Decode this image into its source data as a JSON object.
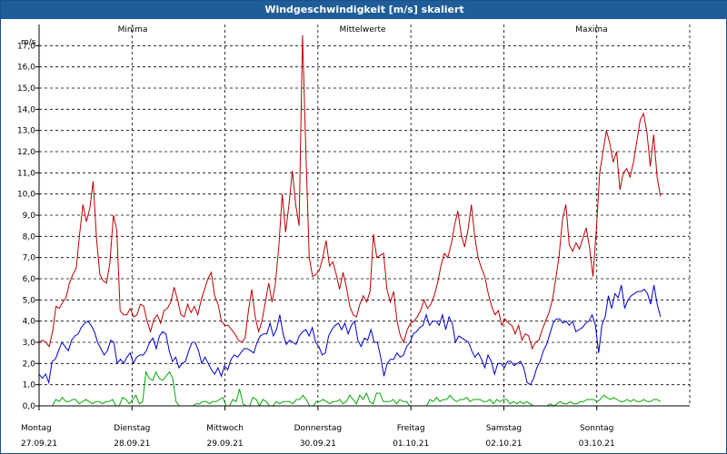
{
  "window": {
    "title": "Windgeschwindigkeit [m/s] skaliert"
  },
  "chart_data": {
    "type": "line",
    "title": "Windgeschwindigkeit [m/s] skaliert",
    "ylabel": "m/s",
    "ylim": [
      0,
      18
    ],
    "y_ticks": [
      "0,0",
      "1,0",
      "2,0",
      "3,0",
      "4,0",
      "5,0",
      "6,0",
      "7,0",
      "8,0",
      "9,0",
      "10,0",
      "11,0",
      "12,0",
      "13,0",
      "14,0",
      "15,0",
      "16,0",
      "17,0"
    ],
    "x_range_days": [
      0,
      7
    ],
    "x_ticks": [
      {
        "day": "Montag",
        "date": "27.09.21"
      },
      {
        "day": "Dienstag",
        "date": "28.09.21"
      },
      {
        "day": "Mittwoch",
        "date": "29.09.21"
      },
      {
        "day": "Donnerstag",
        "date": "30.09.21"
      },
      {
        "day": "Freitag",
        "date": "01.10.21"
      },
      {
        "day": "Samstag",
        "date": "02.10.21"
      },
      {
        "day": "Sonntag",
        "date": "03.10.21"
      }
    ],
    "grid": true,
    "legend_position": "top",
    "series": [
      {
        "name": "Minima",
        "color": "#00aa00",
        "values": [
          0,
          0,
          0,
          0,
          0,
          0.3,
          0.2,
          0.4,
          0.2,
          0.2,
          0.3,
          0.3,
          0.1,
          0.2,
          0.3,
          0.2,
          0.1,
          0.2,
          0.2,
          0.1,
          0.2,
          0.2,
          0.3,
          0,
          0,
          0.4,
          0.3,
          0.1,
          0.3,
          0.5,
          0.1,
          0.2,
          1.6,
          1.3,
          1.2,
          1.6,
          1.3,
          1.2,
          1.4,
          1.6,
          1.3,
          0.2,
          0,
          0,
          0,
          0,
          0,
          0.1,
          0.1,
          0.2,
          0.2,
          0.1,
          0.2,
          0.2,
          0.3,
          0.4,
          0,
          0,
          0.3,
          0.2,
          0.8,
          0.1,
          0,
          0,
          0.4,
          0.3,
          0,
          0.3,
          0.2,
          0,
          0,
          0.2,
          0.1,
          0.2,
          0.2,
          0.2,
          0.1,
          0.3,
          0.3,
          0.5,
          0.3,
          0,
          0,
          0.2,
          0.2,
          0.3,
          0.2,
          0.1,
          0.2,
          0.2,
          0.3,
          0.1,
          0.2,
          0.5,
          0.3,
          0.1,
          0.5,
          0.3,
          0.6,
          0.2,
          0.1,
          0.6,
          0.6,
          0.2,
          0.2,
          0.2,
          0.3,
          0.1,
          0.3,
          0.2,
          0.2,
          0,
          0,
          0,
          0,
          0,
          0,
          0.3,
          0.2,
          0.4,
          0.2,
          0.3,
          0.3,
          0.5,
          0.3,
          0.2,
          0.3,
          0.3,
          0.4,
          0.2,
          0.3,
          0.3,
          0.3,
          0.2,
          0.2,
          0.3,
          0.1,
          0.3,
          0.2,
          0.3,
          0.3,
          0.1,
          0.2,
          0.1,
          0.2,
          0.1,
          0.2,
          0.1,
          0,
          0,
          0,
          0,
          0,
          0.1,
          0,
          0.1,
          0.2,
          0.1,
          0.1,
          0.2,
          0.1,
          0.1,
          0.2,
          0.2,
          0.3,
          0.3,
          0.3,
          0.2,
          0.3,
          0.5,
          0.4,
          0.3,
          0.4,
          0.3,
          0.2,
          0.2,
          0.3,
          0.2,
          0.3,
          0.2,
          0.2,
          0.3,
          0.2,
          0.2,
          0.3,
          0.3,
          0.2
        ]
      },
      {
        "name": "Mittelwerte",
        "color": "#0000cc",
        "values": [
          1.5,
          1.3,
          1.5,
          1.1,
          2.1,
          2.2,
          2.6,
          3.0,
          2.8,
          2.6,
          3.1,
          3.3,
          3.4,
          3.7,
          3.9,
          4.0,
          3.8,
          3.5,
          3.0,
          2.7,
          2.4,
          2.6,
          3.1,
          3.0,
          2.0,
          2.2,
          2.0,
          2.3,
          2.5,
          2.0,
          2.3,
          2.4,
          2.4,
          2.6,
          3.0,
          3.2,
          2.7,
          3.3,
          3.5,
          3.4,
          2.6,
          2.1,
          2.3,
          1.8,
          2.0,
          2.1,
          2.6,
          3.0,
          3.0,
          2.6,
          2.0,
          2.3,
          2.0,
          1.7,
          1.5,
          1.8,
          1.4,
          1.9,
          1.7,
          2.2,
          2.4,
          2.3,
          2.5,
          2.7,
          2.7,
          2.6,
          2.5,
          3.0,
          3.3,
          3.4,
          3.4,
          3.9,
          3.3,
          3.6,
          4.3,
          3.4,
          2.9,
          3.1,
          3.0,
          2.9,
          3.3,
          3.5,
          3.6,
          3.3,
          3.7,
          3.0,
          2.8,
          2.4,
          2.5,
          3.3,
          3.6,
          3.8,
          3.9,
          3.6,
          3.9,
          3.4,
          3.8,
          4.0,
          3.1,
          2.8,
          3.2,
          3.1,
          3.6,
          3.0,
          3.0,
          2.3,
          1.4,
          2.0,
          2.2,
          2.2,
          2.5,
          2.3,
          2.4,
          2.8,
          3.0,
          3.4,
          3.5,
          3.7,
          3.8,
          4.3,
          3.8,
          4.0,
          4.0,
          3.8,
          4.3,
          3.6,
          4.2,
          3.9,
          3.0,
          3.3,
          3.2,
          3.1,
          3.0,
          2.6,
          2.3,
          2.5,
          2.2,
          1.8,
          2.4,
          2.1,
          1.5,
          2.0,
          2.0,
          1.8,
          2.1,
          2.1,
          1.9,
          2.0,
          2.1,
          1.8,
          1.1,
          1.0,
          1.3,
          1.8,
          2.1,
          2.6,
          2.9,
          3.4,
          3.9,
          4.1,
          4.1,
          3.9,
          4.0,
          3.8,
          4.0,
          3.5,
          3.6,
          3.7,
          3.9,
          4.0,
          4.3,
          3.8,
          2.5,
          3.8,
          4.2,
          5.2,
          4.6,
          5.3,
          5.1,
          5.7,
          4.6,
          5.0,
          5.2,
          5.3,
          5.4,
          5.4,
          5.5,
          5.3,
          4.8,
          5.7,
          4.8,
          4.2
        ]
      },
      {
        "name": "Maxima",
        "color": "#bb0000",
        "values": [
          3.0,
          3.1,
          3.0,
          2.8,
          3.5,
          4.7,
          4.6,
          4.9,
          5.1,
          5.8,
          6.2,
          6.5,
          8.1,
          9.5,
          8.7,
          9.3,
          10.6,
          7.9,
          6.2,
          5.9,
          5.8,
          6.8,
          9.0,
          8.3,
          4.5,
          4.3,
          4.3,
          4.6,
          4.2,
          4.3,
          4.8,
          4.7,
          4.0,
          3.5,
          4.1,
          4.3,
          3.9,
          4.5,
          4.6,
          4.9,
          5.6,
          5.0,
          4.3,
          4.2,
          4.8,
          4.4,
          4.7,
          4.3,
          5.0,
          5.5,
          6.0,
          6.3,
          5.2,
          4.8,
          4.0,
          3.8,
          3.8,
          3.6,
          3.4,
          3.1,
          3.0,
          3.2,
          4.5,
          5.5,
          4.2,
          3.5,
          4.0,
          4.9,
          5.8,
          4.9,
          5.8,
          7.5,
          10.0,
          8.2,
          9.5,
          11.1,
          9.5,
          8.5,
          17.5,
          12.0,
          7.0,
          6.1,
          6.2,
          6.4,
          7.0,
          7.8,
          6.6,
          6.8,
          6.2,
          5.5,
          6.3,
          5.6,
          4.7,
          4.3,
          4.2,
          4.8,
          5.2,
          4.9,
          5.4,
          8.1,
          7.0,
          7.1,
          7.2,
          5.5,
          4.9,
          5.4,
          4.0,
          3.3,
          3.0,
          3.6,
          3.9,
          4.0,
          4.2,
          4.5,
          5.0,
          4.6,
          4.8,
          5.2,
          5.8,
          6.6,
          7.2,
          7.0,
          7.6,
          8.5,
          9.2,
          8.1,
          7.5,
          8.3,
          9.5,
          8.0,
          7.0,
          6.5,
          6.1,
          5.3,
          4.7,
          4.3,
          4.5,
          3.8,
          4.1,
          3.9,
          3.8,
          3.4,
          3.8,
          3.1,
          3.4,
          3.3,
          2.7,
          3.0,
          3.1,
          3.6,
          4.0,
          4.4,
          5.0,
          6.0,
          7.1,
          8.8,
          9.5,
          7.6,
          7.3,
          7.7,
          7.4,
          7.9,
          8.4,
          7.5,
          6.1,
          8.3,
          11.0,
          12.0,
          13.0,
          12.4,
          11.5,
          12.0,
          10.2,
          11.0,
          11.2,
          10.8,
          11.5,
          12.5,
          13.5,
          13.8,
          12.9,
          11.3,
          12.8,
          10.8,
          9.9
        ]
      }
    ]
  }
}
